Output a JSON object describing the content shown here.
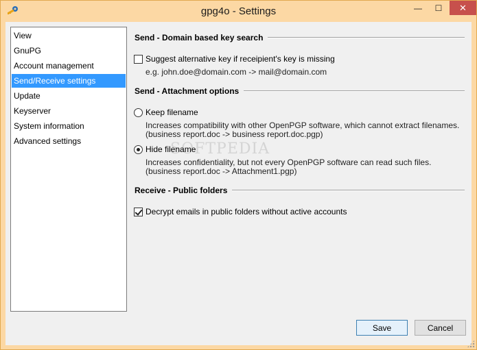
{
  "window": {
    "title": "gpg4o - Settings",
    "controls": {
      "minimize": "—",
      "maximize": "☐",
      "close": "✕"
    },
    "icon": "gpg4o-key-icon"
  },
  "nav": {
    "items": [
      {
        "label": "View",
        "selected": false
      },
      {
        "label": "GnuPG",
        "selected": false
      },
      {
        "label": "Account management",
        "selected": false
      },
      {
        "label": "Send/Receive settings",
        "selected": true
      },
      {
        "label": "Update",
        "selected": false
      },
      {
        "label": "Keyserver",
        "selected": false
      },
      {
        "label": "System information",
        "selected": false
      },
      {
        "label": "Advanced settings",
        "selected": false
      }
    ]
  },
  "send_domain": {
    "heading": "Send - Domain based key search",
    "suggest_label": "Suggest alternative key if receipient's key is missing",
    "suggest_checked": false,
    "example": "e.g. john.doe@domain.com -> mail@domain.com"
  },
  "send_attachment": {
    "heading": "Send - Attachment options",
    "keep_label": "Keep filename",
    "keep_desc_1": "Increases compatibility with other OpenPGP software, which cannot extract filenames.",
    "keep_desc_2": "(business report.doc -> business report.doc.pgp)",
    "hide_label": "Hide filename",
    "hide_desc_1": "Increases confidentiality, but not every OpenPGP software can read such files.",
    "hide_desc_2": "(business report.doc -> Attachment1.pgp)",
    "selected": "hide"
  },
  "receive_public": {
    "heading": "Receive - Public folders",
    "decrypt_label": "Decrypt emails in public folders without active accounts",
    "decrypt_checked": true
  },
  "buttons": {
    "save": "Save",
    "cancel": "Cancel"
  },
  "watermark": "SOFTPEDIA",
  "colors": {
    "frame": "#fcd8a4",
    "selection": "#3399ff",
    "close": "#c7504c"
  }
}
